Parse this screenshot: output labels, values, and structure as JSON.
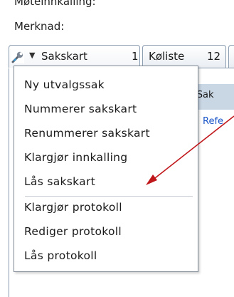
{
  "form": {
    "meteinnkalling_label": "Møteinnkalling:",
    "merknad_label": "Merknad:"
  },
  "tabs": [
    {
      "label": "Sakskart",
      "count": "1"
    },
    {
      "label": "Køliste",
      "count": "12"
    }
  ],
  "panel": {
    "header_fragment": "ı Sak",
    "link_fragment": "Refe"
  },
  "menu": {
    "items": [
      {
        "label": "Ny utvalgssak"
      },
      {
        "label": "Nummerer sakskart"
      },
      {
        "label": "Renummerer sakskart"
      },
      {
        "label": "Klargjør innkalling"
      },
      {
        "label": "Lås sakskart"
      },
      {
        "label": "Klargjør protokoll"
      },
      {
        "label": "Rediger protokoll"
      },
      {
        "label": "Lås protokoll"
      }
    ]
  },
  "colors": {
    "annotation_arrow": "#c0171b",
    "link": "#1a55c8",
    "header_fill": "#c9d6e3"
  }
}
